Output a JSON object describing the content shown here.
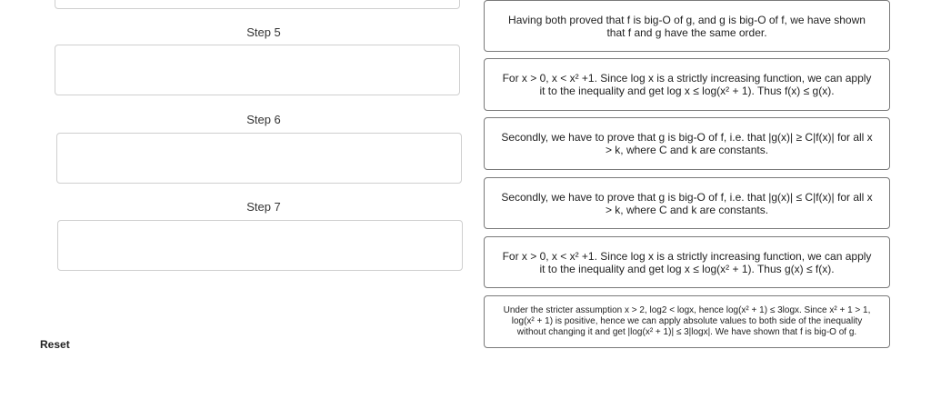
{
  "steps": [
    {
      "label": "Step 5"
    },
    {
      "label": "Step 6"
    },
    {
      "label": "Step 7"
    }
  ],
  "cards": [
    "Having both proved that f is big-O of g, and g is big-O of f, we have shown that f and g have the same order.",
    "For x > 0, x < x² +1. Since log x is a strictly increasing function, we can apply it to the inequality and get log x ≤ log(x² + 1). Thus f(x) ≤ g(x).",
    "Secondly, we have to prove that g is big-O of f, i.e. that |g(x)| ≥ C|f(x)| for all x > k, where C and k are constants.",
    "Secondly, we have to prove that g is big-O of f, i.e. that |g(x)| ≤ C|f(x)| for all x > k, where C and k are constants.",
    "For x > 0, x < x² +1. Since log x is a strictly increasing function, we can apply it to the inequality and get log x ≤ log(x² + 1). Thus g(x) ≤ f(x).",
    "Under the stricter assumption x > 2, log2 < logx, hence log(x² + 1) ≤ 3logx. Since x² + 1 > 1, log(x² + 1) is positive, hence we can apply absolute values to both side of the inequality without changing it and get |log(x² + 1)| ≤ 3|logx|. We have shown that f is big-O of g."
  ],
  "reset_label": "Reset"
}
